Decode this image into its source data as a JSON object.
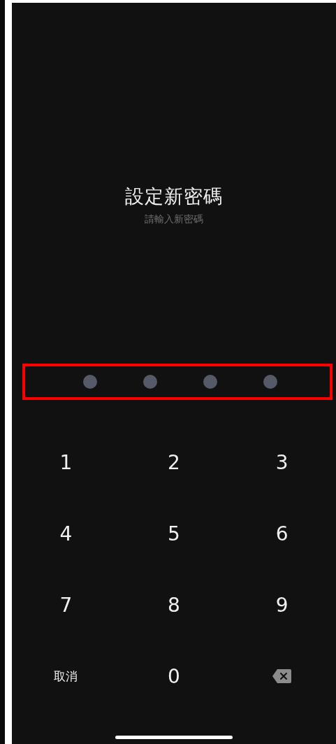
{
  "title": "設定新密碼",
  "subtitle": "請輸入新密碼",
  "highlight": {
    "shown": true
  },
  "dots": [
    {
      "filled": false
    },
    {
      "filled": false
    },
    {
      "filled": false
    },
    {
      "filled": false
    }
  ],
  "keys": [
    {
      "kind": "digit",
      "label": "1"
    },
    {
      "kind": "digit",
      "label": "2"
    },
    {
      "kind": "digit",
      "label": "3"
    },
    {
      "kind": "digit",
      "label": "4"
    },
    {
      "kind": "digit",
      "label": "5"
    },
    {
      "kind": "digit",
      "label": "6"
    },
    {
      "kind": "digit",
      "label": "7"
    },
    {
      "kind": "digit",
      "label": "8"
    },
    {
      "kind": "digit",
      "label": "9"
    },
    {
      "kind": "text",
      "label": "取消"
    },
    {
      "kind": "digit",
      "label": "0"
    },
    {
      "kind": "backspace"
    }
  ]
}
